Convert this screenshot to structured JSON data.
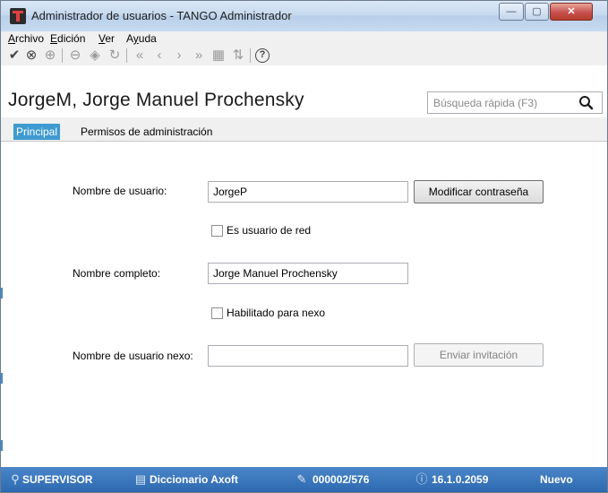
{
  "window": {
    "title": "Administrador de usuarios - TANGO Administrador",
    "minimize_glyph": "—",
    "maximize_glyph": "▢",
    "close_glyph": "✕"
  },
  "menu": {
    "items": [
      {
        "accel": "A",
        "rest": "rchivo"
      },
      {
        "accel": "E",
        "rest": "dición"
      },
      {
        "accel": "V",
        "rest": "er"
      },
      {
        "pre": "A",
        "accel": "y",
        "rest": "uda"
      }
    ]
  },
  "toolbar": {
    "icons": [
      {
        "name": "confirm-icon",
        "glyph": "✔"
      },
      {
        "name": "cancel-icon",
        "glyph": "⊗"
      },
      {
        "name": "add-icon",
        "glyph": "⊕"
      },
      {
        "name": "remove-icon",
        "glyph": "⊖"
      },
      {
        "name": "copy-icon",
        "glyph": "◈"
      },
      {
        "name": "refresh-icon",
        "glyph": "↻"
      },
      {
        "name": "first-record-icon",
        "glyph": "«"
      },
      {
        "name": "previous-record-icon",
        "glyph": "‹"
      },
      {
        "name": "next-record-icon",
        "glyph": "›"
      },
      {
        "name": "last-record-icon",
        "glyph": "»"
      },
      {
        "name": "grid-view-icon",
        "glyph": "▦"
      },
      {
        "name": "sort-icon",
        "glyph": "⇅"
      },
      {
        "name": "help-icon",
        "glyph": "?"
      }
    ]
  },
  "header": {
    "title": "JorgeM, Jorge Manuel Prochensky",
    "search_placeholder": "Búsqueda rápida (F3)"
  },
  "tabs": [
    {
      "label": "Principal",
      "selected": true
    },
    {
      "label": "Permisos de administración",
      "selected": false
    }
  ],
  "form": {
    "username_label": "Nombre de usuario:",
    "username_value": "JorgeP",
    "change_password_label": "Modificar contraseña",
    "network_user_label": "Es usuario de red",
    "network_user_checked": false,
    "fullname_label": "Nombre completo:",
    "fullname_value": "Jorge Manuel Prochensky",
    "nexo_enabled_label": "Habilitado para nexo",
    "nexo_enabled_checked": false,
    "nexo_username_label": "Nombre de usuario nexo:",
    "nexo_username_value": "",
    "send_invitation_label": "Enviar invitación"
  },
  "status": {
    "user": "SUPERVISOR",
    "dictionary": "Diccionario Axoft",
    "record": "000002/576",
    "version": "16.1.0.2059",
    "mode": "Nuevo"
  },
  "colors": {
    "accent": "#3e9ad0",
    "statusbar": "#2e6ab0"
  }
}
